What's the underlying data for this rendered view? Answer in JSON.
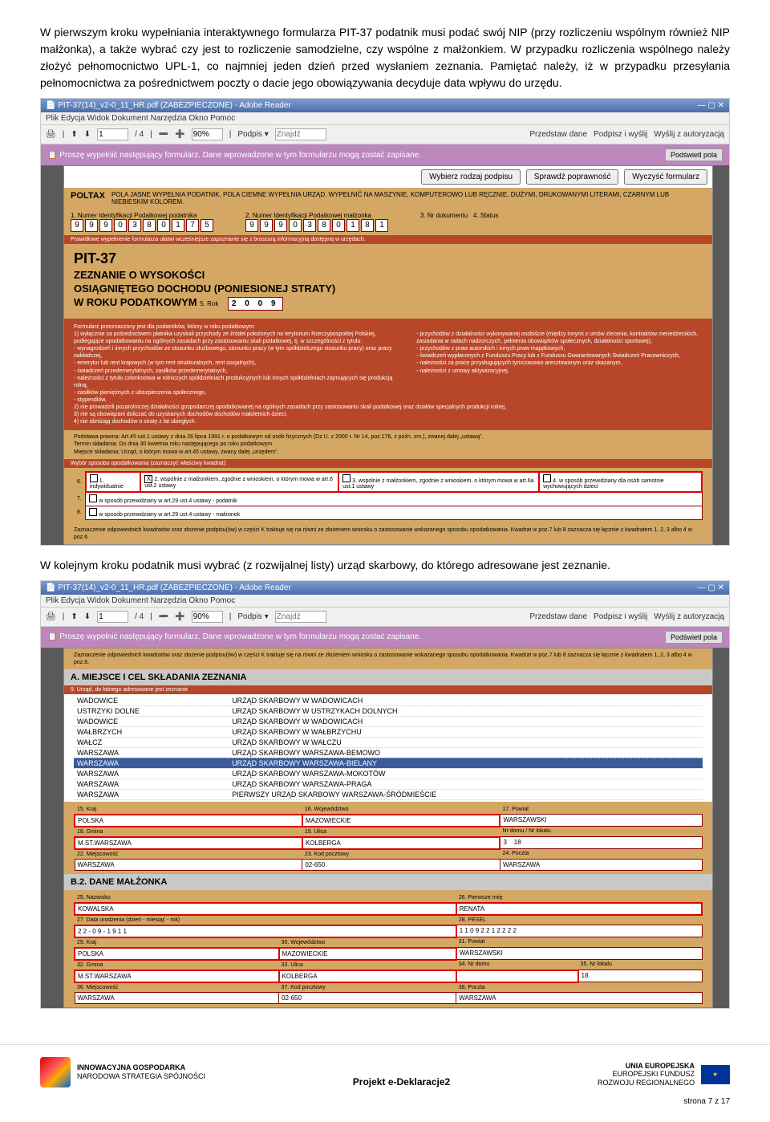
{
  "para1": "W pierwszym kroku wypełniania interaktywnego formularza PIT-37 podatnik musi podać swój NIP (przy rozliczeniu wspólnym również NIP małżonka), a także wybrać czy jest to rozliczenie samodzielne, czy wspólne z małżonkiem. W przypadku rozliczenia wspólnego należy złożyć pełnomocnictwo UPL-1, co najmniej jeden dzień przed wysłaniem zeznania. Pamiętać należy, iż w przypadku przesyłania pełnomocnictwa za pośrednictwem poczty o dacie jego obowiązywania decyduje data wpływu do urzędu.",
  "para2": "W kolejnym kroku podatnik musi wybrać (z rozwijalnej listy) urząd skarbowy, do którego adresowane jest zeznanie.",
  "adobe": {
    "title": "PIT-37(14)_v2-0_11_HR.pdf (ZABEZPIECZONE) - Adobe Reader",
    "menu": "Plik  Edycja  Widok  Dokument  Narzędzia  Okno  Pomoc",
    "page": "1",
    "pages": "/ 4",
    "zoom": "90%",
    "podpis": "Podpis ▾",
    "find": "Znajdź",
    "btn1": "Przedstaw dane",
    "btn2": "Podpisz i wyślij",
    "btn3": "Wyślij z autoryzacją",
    "purple": "Proszę wypełnić następujący formularz. Dane wprowadzone w tym formularzu mogą zostać zapisane.",
    "podswietl": "Podświetl pola"
  },
  "pit": {
    "b1": "Wybierz rodzaj podpisu",
    "b2": "Sprawdź poprawność",
    "b3": "Wyczyść formularz",
    "poltax": "POLTAX",
    "poltaxtxt": "POLA JASNE WYPEŁNIA PODATNIK, POLA CIEMNE WYPEŁNIA URZĄD. WYPEŁNIĆ NA MASZYNIE, KOMPUTEROWO LUB RĘCZNIE, DUŻYMI, DRUKOWANYMI LITERAMI, CZARNYM LUB NIEBIESKIM KOLOREM.",
    "h1_1": "1. Numer Identyfikacji Podatkowej podatnika",
    "h1_2": "2. Numer Identyfikacji Podatkowej małżonka",
    "h1_3": "3. Nr dokumentu",
    "h1_4": "4. Status",
    "nip1": [
      "9",
      "9",
      "9",
      "0",
      "3",
      "8",
      "0",
      "1",
      "7",
      "5"
    ],
    "nip2": [
      "9",
      "9",
      "9",
      "0",
      "3",
      "8",
      "0",
      "1",
      "8",
      "1"
    ],
    "stripe": "Prawidłowe wypełnienie formularza ułatwi wcześniejsze zapoznanie się z broszurą informacyjną dostępną w urzędach.",
    "name": "PIT-37",
    "t1": "ZEZNANIE O WYSOKOŚCI",
    "t2": "OSIĄGNIĘTEGO DOCHODU (PONIESIONEJ STRATY)",
    "t3": "W ROKU PODATKOWYM",
    "roklbl": "5. Rok",
    "rok": "2 0 0 9",
    "dt1": "Formularz przeznaczony jest dla podatników, którzy w roku podatkowym:",
    "dt_lines": [
      "1) wyłącznie za pośrednictwem płatnika uzyskali przychody ze źródeł położonych na terytorium Rzeczypospolitej Polskiej, podlegające opodatkowaniu na ogólnych zasadach przy zastosowaniu skali podatkowej, tj. w szczególności z tytułu:",
      "- wynagrodzeń i innych przychodów ze stosunku służbowego, stosunku pracy (w tym spółdzielczego stosunku pracy) oraz pracy nakładczej,",
      "- emerytur lub rent krajowych (w tym rent strukturalnych, rent socjalnych),",
      "- świadczeń przedemerytalnych, zasiłków przedemerytalnych,",
      "- należności z tytułu członkostwa w rolniczych spółdzielniach produkcyjnych lub innych spółdzielniach zajmujących się produkcją rolną,",
      "- zasiłków pieniężnych z ubezpieczenia społecznego,",
      "- stypendiów,"
    ],
    "dt_right": [
      "- przychodów z działalności wykonywanej osobiście (między innymi z umów zlecenia, kontraktów menedżerskich, zasiadania w radach nadzorczych, pełnienia obowiązków społecznych, działalności sportowej),",
      "- przychodów z praw autorskich i innych praw majątkowych,",
      "- świadczeń wypłaconych z Funduszu Pracy lub z Funduszu Gwarantowanych Świadczeń Pracowniczych,",
      "- należności za pracę przysługujących tymczasowo aresztowanym oraz skazanym,",
      "- należności z umowy aktywizacyjnej,"
    ],
    "dt2": "2) nie prowadzili pozarolniczej działalności gospodarczej opodatkowanej na ogólnych zasadach przy zastosowaniu skali podatkowej oraz działów specjalnych produkcji rolnej,",
    "dt3": "3) nie są obowiązani doliczać do uzyskanych dochodów dochodów małoletnich dzieci,",
    "dt4": "4) nie obniżają dochodów o straty z lat ubiegłych.",
    "lp": "Podstawa prawna:",
    "lpt": "Art.45 ust.1 ustawy z dnia 26 lipca 1991 r. o podatkowym od osób fizycznych (Dz.U. z 2000 r. Nr 14, poz.176, z późn. zm.), zwanej dalej „ustawą\".",
    "ts": "Termin składania:",
    "tst": "Do dnia 30 kwietnia roku następującego po roku podatkowym.",
    "ms": "Miejsce składania:",
    "mst": "Urząd, o którym mowa w art.45 ustawy, zwany dalej „urzędem\".",
    "wyb": "Wybór sposobu opodatkowania (zaznaczyć właściwy kwadrat):",
    "w6": "6.",
    "w1": "1. indywidualnie",
    "w2": "2. wspólnie z małżonkiem, zgodnie z wnioskiem, o którym mowa w art.6 ust.2 ustawy",
    "w3": "3. wspólnie z małżonkiem, zgodnie z wnioskiem, o którym mowa w art.6a ust.1 ustawy",
    "w4": "4. w sposób przewidziany dla osób samotnie wychowujących dzieci",
    "w7": "7.",
    "w7t": "w sposób przewidziany w art.29 ust.4 ustawy - podatnik",
    "w8": "8.",
    "w8t": "w sposób przewidziany w art.29 ust.4 ustawy - małżonek",
    "zazn": "Zaznaczenie odpowiednich kwadratów oraz złożenie podpisu(ów) w części K traktuje się na równi ze złożeniem wniosku o zastosowanie wskazanego sposobu opodatkowania. Kwadrat w poz.7 lub 8 zaznacza się łącznie z kwadratem 1, 2, 3 albo 4 w poz.6."
  },
  "sectA": "A. MIEJSCE I CEL SKŁADANIA ZEZNANIA",
  "sectA9": "9. Urząd, do którego adresowane jest zeznanie",
  "urzedy": [
    [
      "WADOWICE",
      "URZĄD SKARBOWY W WADOWICACH"
    ],
    [
      "USTRZYKI DOLNE",
      "URZĄD SKARBOWY W USTRZYKACH DOLNYCH"
    ],
    [
      "WADOWICE",
      "URZĄD SKARBOWY W WADOWICACH"
    ],
    [
      "WAŁBRZYCH",
      "URZĄD SKARBOWY W WAŁBRZYCHU"
    ],
    [
      "WAŁCZ",
      "URZĄD SKARBOWY W WAŁCZU"
    ],
    [
      "WARSZAWA",
      "URZĄD SKARBOWY WARSZAWA-BEMOWO"
    ],
    [
      "WARSZAWA",
      "URZĄD SKARBOWY WARSZAWA-BIELANY"
    ],
    [
      "WARSZAWA",
      "URZĄD SKARBOWY WARSZAWA-MOKOTÓW"
    ],
    [
      "WARSZAWA",
      "URZĄD SKARBOWY WARSZAWA-PRAGA"
    ],
    [
      "WARSZAWA",
      "PIERWSZY URZĄD SKARBOWY WARSZAWA-ŚRÓDMIEŚCIE"
    ]
  ],
  "daneB": {
    "kraj": "15. Kraj",
    "krajv": "POLSKA",
    "woj": "16. Województwo",
    "wojv": "MAZOWIECKIE",
    "pow": "17. Powiat",
    "powv": "WARSZAWSKI",
    "gm": "18. Gmina",
    "gmv": "M.ST.WARSZAWA",
    "ul": "19. Ulica",
    "ulv": "KOLBERGA",
    "nd": "Nr domu",
    "ndv": "3",
    "nl": "Nr lokalu",
    "nlv": "18",
    "msc": "22. Miejscowość",
    "mscv": "WARSZAWA",
    "kp": "23. Kod pocztowy",
    "kpv": "02-650",
    "pcz": "24. Poczta",
    "pczv": "WARSZAWA"
  },
  "sectB2": "B.2. DANE MAŁŻONKA",
  "daneB2": {
    "nz": "25. Nazwisko",
    "nzv": "KOWALSKA",
    "im": "26. Pierwsze imię",
    "imv": "RENATA",
    "du": "27. Data urodzenia (dzień - miesiąc - rok)",
    "duv": "2 2 - 0 9 - 1 9 1 1",
    "ps": "28. PESEL",
    "psv": "1 1 0 9 2 2 1 2 2 2 2",
    "kraj": "29. Kraj",
    "krajv": "POLSKA",
    "woj": "30. Województwo",
    "wojv": "MAZOWIECKIE",
    "pow": "31. Powiat",
    "powv": "WARSZAWSKI",
    "gm": "32. Gmina",
    "gmv": "M.ST.WARSZAWA",
    "ul": "33. Ulica",
    "ulv": "KOLBERGA",
    "nd": "34. Nr domu",
    "ndv": "",
    "nl": "35. Nr lokalu",
    "nlv": "18",
    "msc": "36. Miejscowość",
    "mscv": "WARSZAWA",
    "kp": "37. Kod pocztowy",
    "kpv": "02-650",
    "pcz": "38. Poczta",
    "pczv": "WARSZAWA"
  },
  "footer": {
    "ig1": "INNOWACYJNA GOSPODARKA",
    "ig2": "NARODOWA STRATEGIA SPÓJNOŚCI",
    "eu1": "UNIA EUROPEJSKA",
    "eu2": "EUROPEJSKI FUNDUSZ",
    "eu3": "ROZWOJU REGIONALNEGO",
    "proj": "Projekt e-Deklaracje2",
    "page": "strona 7 z 17"
  }
}
